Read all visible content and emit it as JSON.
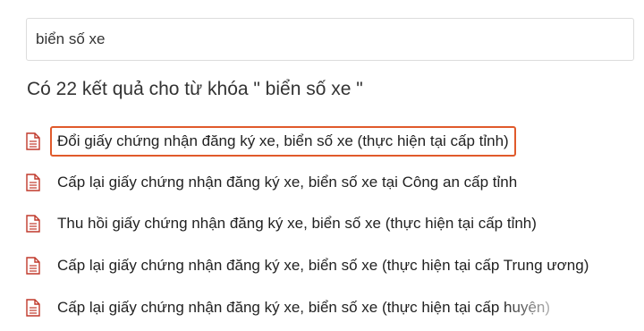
{
  "search": {
    "value": "biển số xe"
  },
  "heading": "Có 22 kết quả cho từ khóa \" biển số xe \"",
  "results": [
    {
      "label": "Đổi giấy chứng nhận đăng ký xe, biển số xe (thực hiện tại cấp tỉnh)",
      "highlighted": true,
      "icon": "document-icon"
    },
    {
      "label": "Cấp lại giấy chứng nhận đăng ký xe, biển số xe tại Công an cấp tỉnh",
      "highlighted": false,
      "icon": "document-icon"
    },
    {
      "label": "Thu hồi giấy chứng nhận đăng ký xe, biển số xe (thực hiện tại cấp tỉnh)",
      "highlighted": false,
      "icon": "document-icon"
    },
    {
      "label": "Cấp lại giấy chứng nhận đăng ký xe, biển số xe (thực hiện tại cấp Trung ương)",
      "highlighted": false,
      "icon": "document-icon"
    },
    {
      "label": "Cấp lại giấy chứng nhận đăng ký xe, biển số xe (thực hiện tại cấp huyện)",
      "highlighted": false,
      "icon": "document-icon"
    }
  ],
  "colors": {
    "icon": "#c0392b",
    "highlight_border": "#e05a2b"
  }
}
